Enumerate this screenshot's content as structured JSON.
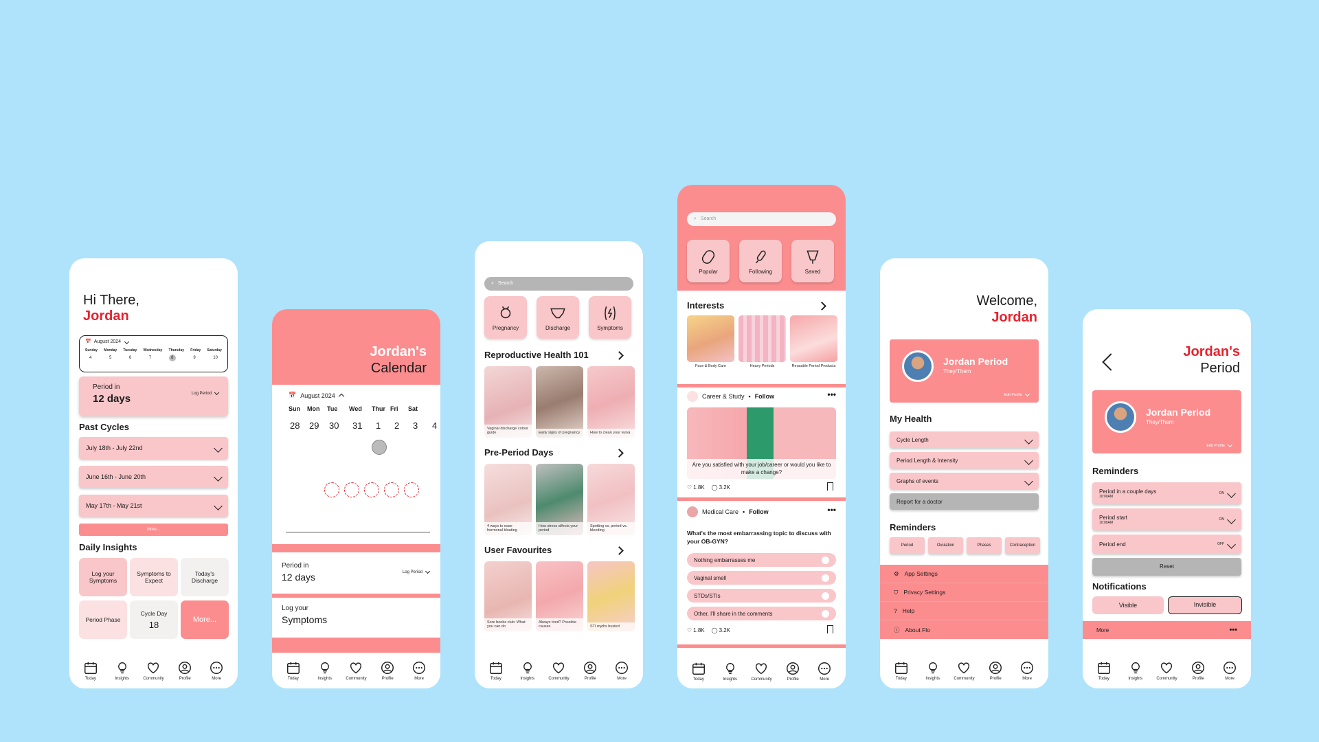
{
  "tabs": [
    "Today",
    "Insights",
    "Community",
    "Profile",
    "More"
  ],
  "colors": {
    "background": "#aee3fb",
    "salmon": "#fb8d8f",
    "pink": "#f9c6c9",
    "accent_red": "#e8212d",
    "grey": "#b5b5b5"
  },
  "s1": {
    "greeting": "Hi There,",
    "name": "Jordan",
    "month": "August 2024",
    "week_days": [
      "Sunday",
      "Monday",
      "Tuesday",
      "Wednesday",
      "Thursday",
      "Friday",
      "Saturday"
    ],
    "week_dates": [
      "4",
      "5",
      "6",
      "7",
      "8",
      "9",
      "10"
    ],
    "period_in": "Period in",
    "period_days": "12 days",
    "log_period": "Log Period",
    "past_cycles_title": "Past Cycles",
    "cycles": [
      "July 18th - July 22nd",
      "June 16th - June 20th",
      "May 17th - May 21st"
    ],
    "more_btn": "More...",
    "daily_title": "Daily Insights",
    "tiles": [
      "Log your Symptoms",
      "Symptoms to Expect",
      "Today's Discharge",
      "Period Phase",
      "Cycle Day",
      "More..."
    ],
    "cycle_day_num": "18"
  },
  "s2": {
    "title1": "Jordan's",
    "title2": "Calendar",
    "month": "August 2024",
    "days": [
      "Sun",
      "Mon",
      "Tue",
      "Wed",
      "Thur",
      "Fri",
      "Sat"
    ],
    "dates": [
      "28",
      "29",
      "30",
      "31",
      "1",
      "2",
      "3",
      "4"
    ],
    "period_in": "Period in",
    "period_days": "12 days",
    "log_period": "Log Period",
    "log_your": "Log your",
    "symptoms": "Symptoms"
  },
  "s3": {
    "search_placeholder": "Search",
    "cats": [
      "Pregnancy",
      "Discharge",
      "Symptoms"
    ],
    "sec1": "Reproductive Health 101",
    "sec1_caps": [
      "Vaginal discharge colour guide",
      "Early signs of pregnancy",
      "How to clean your vulva"
    ],
    "sec2": "Pre-Period Days",
    "sec2_caps": [
      "4 ways to ease hormonal bloating",
      "How stress affects your period",
      "Spotting vs. period vs. bleeding"
    ],
    "sec3": "User Favourites",
    "sec3_caps": [
      "Sore boobs club: What you can do",
      "Always tired? Possible causes",
      "STI myths busted"
    ]
  },
  "s4": {
    "search_placeholder": "Search",
    "cats": [
      "Popular",
      "Following",
      "Saved"
    ],
    "interests": "Interests",
    "interest_caps": [
      "Face & Body Care",
      "Heavy Periods",
      "Reusable Period Products"
    ],
    "post1_group": "Career & Study",
    "follow": "Follow",
    "post1_question": "Are you satisfied with your job/career or would you like to make a change?",
    "likes": "1.8K",
    "comments": "3.2K",
    "post2_group": "Medical Care",
    "post2_question": "What's the most embarrassing topic to discuss with your OB-GYN?",
    "options": [
      "Nothing embarrasses me",
      "Vaginal smell",
      "STDs/STIs",
      "Other, I'll share in the comments"
    ]
  },
  "s5": {
    "welcome": "Welcome,",
    "name": "Jordan",
    "profile_name": "Jordan Period",
    "pronouns": "They/Them",
    "edit_profile": "Edit Profile",
    "my_health": "My Health",
    "health_items": [
      "Cycle Length",
      "Period Length & Intensity",
      "Graphs of events"
    ],
    "report": "Report for a doctor",
    "reminders": "Reminders",
    "reminder_chips": [
      "Period",
      "Ovulation",
      "Phases",
      "Contraception"
    ],
    "menu": [
      "App Settings",
      "Privacy Settings",
      "Help",
      "About Flo"
    ]
  },
  "s6": {
    "title1": "Jordan's",
    "title2": "Period",
    "profile_name": "Jordan Period",
    "pronouns": "They/Them",
    "edit_profile": "Edit Profile",
    "reminders": "Reminders",
    "rem": [
      {
        "label": "Period in a couple days",
        "time": "10:00AM",
        "state": "ON"
      },
      {
        "label": "Period start",
        "time": "10:00AM",
        "state": "ON"
      },
      {
        "label": "Period end",
        "time": "",
        "state": "OFF"
      }
    ],
    "reset": "Reset",
    "notifications": "Notifications",
    "visible": "Visible",
    "invisible": "Invisible",
    "more": "More"
  }
}
